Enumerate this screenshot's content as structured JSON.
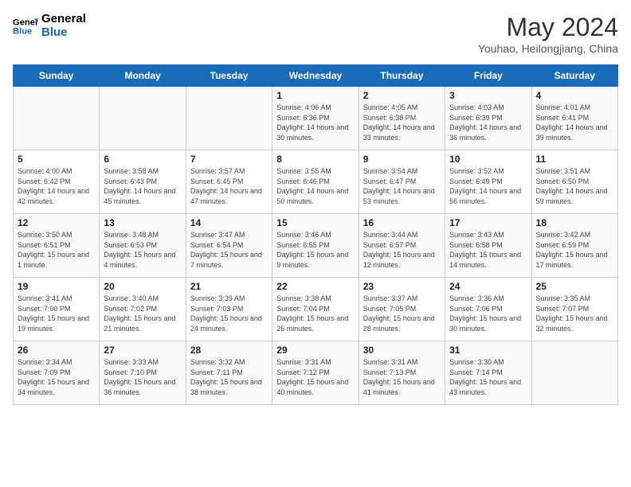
{
  "header": {
    "logo_line1": "General",
    "logo_line2": "Blue",
    "month_title": "May 2024",
    "location": "Youhao, Heilongjiang, China"
  },
  "days_of_week": [
    "Sunday",
    "Monday",
    "Tuesday",
    "Wednesday",
    "Thursday",
    "Friday",
    "Saturday"
  ],
  "weeks": [
    [
      {
        "day": "",
        "sunrise": "",
        "sunset": "",
        "daylight": ""
      },
      {
        "day": "",
        "sunrise": "",
        "sunset": "",
        "daylight": ""
      },
      {
        "day": "",
        "sunrise": "",
        "sunset": "",
        "daylight": ""
      },
      {
        "day": "1",
        "sunrise": "4:06 AM",
        "sunset": "6:36 PM",
        "daylight": "14 hours and 30 minutes."
      },
      {
        "day": "2",
        "sunrise": "4:05 AM",
        "sunset": "6:38 PM",
        "daylight": "14 hours and 33 minutes."
      },
      {
        "day": "3",
        "sunrise": "4:03 AM",
        "sunset": "6:39 PM",
        "daylight": "14 hours and 36 minutes."
      },
      {
        "day": "4",
        "sunrise": "4:01 AM",
        "sunset": "6:41 PM",
        "daylight": "14 hours and 39 minutes."
      }
    ],
    [
      {
        "day": "5",
        "sunrise": "4:00 AM",
        "sunset": "6:42 PM",
        "daylight": "14 hours and 42 minutes."
      },
      {
        "day": "6",
        "sunrise": "3:58 AM",
        "sunset": "6:43 PM",
        "daylight": "14 hours and 45 minutes."
      },
      {
        "day": "7",
        "sunrise": "3:57 AM",
        "sunset": "6:45 PM",
        "daylight": "14 hours and 47 minutes."
      },
      {
        "day": "8",
        "sunrise": "3:55 AM",
        "sunset": "6:46 PM",
        "daylight": "14 hours and 50 minutes."
      },
      {
        "day": "9",
        "sunrise": "3:54 AM",
        "sunset": "6:47 PM",
        "daylight": "14 hours and 53 minutes."
      },
      {
        "day": "10",
        "sunrise": "3:52 AM",
        "sunset": "6:49 PM",
        "daylight": "14 hours and 56 minutes."
      },
      {
        "day": "11",
        "sunrise": "3:51 AM",
        "sunset": "6:50 PM",
        "daylight": "14 hours and 59 minutes."
      }
    ],
    [
      {
        "day": "12",
        "sunrise": "3:50 AM",
        "sunset": "6:51 PM",
        "daylight": "15 hours and 1 minute."
      },
      {
        "day": "13",
        "sunrise": "3:48 AM",
        "sunset": "6:53 PM",
        "daylight": "15 hours and 4 minutes."
      },
      {
        "day": "14",
        "sunrise": "3:47 AM",
        "sunset": "6:54 PM",
        "daylight": "15 hours and 7 minutes."
      },
      {
        "day": "15",
        "sunrise": "3:46 AM",
        "sunset": "6:55 PM",
        "daylight": "15 hours and 9 minutes."
      },
      {
        "day": "16",
        "sunrise": "3:44 AM",
        "sunset": "6:57 PM",
        "daylight": "15 hours and 12 minutes."
      },
      {
        "day": "17",
        "sunrise": "3:43 AM",
        "sunset": "6:58 PM",
        "daylight": "15 hours and 14 minutes."
      },
      {
        "day": "18",
        "sunrise": "3:42 AM",
        "sunset": "6:59 PM",
        "daylight": "15 hours and 17 minutes."
      }
    ],
    [
      {
        "day": "19",
        "sunrise": "3:41 AM",
        "sunset": "7:00 PM",
        "daylight": "15 hours and 19 minutes."
      },
      {
        "day": "20",
        "sunrise": "3:40 AM",
        "sunset": "7:02 PM",
        "daylight": "15 hours and 21 minutes."
      },
      {
        "day": "21",
        "sunrise": "3:39 AM",
        "sunset": "7:03 PM",
        "daylight": "15 hours and 24 minutes."
      },
      {
        "day": "22",
        "sunrise": "3:38 AM",
        "sunset": "7:04 PM",
        "daylight": "15 hours and 26 minutes."
      },
      {
        "day": "23",
        "sunrise": "3:37 AM",
        "sunset": "7:05 PM",
        "daylight": "15 hours and 28 minutes."
      },
      {
        "day": "24",
        "sunrise": "3:36 AM",
        "sunset": "7:06 PM",
        "daylight": "15 hours and 30 minutes."
      },
      {
        "day": "25",
        "sunrise": "3:35 AM",
        "sunset": "7:07 PM",
        "daylight": "15 hours and 32 minutes."
      }
    ],
    [
      {
        "day": "26",
        "sunrise": "3:34 AM",
        "sunset": "7:09 PM",
        "daylight": "15 hours and 34 minutes."
      },
      {
        "day": "27",
        "sunrise": "3:33 AM",
        "sunset": "7:10 PM",
        "daylight": "15 hours and 36 minutes."
      },
      {
        "day": "28",
        "sunrise": "3:32 AM",
        "sunset": "7:11 PM",
        "daylight": "15 hours and 38 minutes."
      },
      {
        "day": "29",
        "sunrise": "3:31 AM",
        "sunset": "7:12 PM",
        "daylight": "15 hours and 40 minutes."
      },
      {
        "day": "30",
        "sunrise": "3:31 AM",
        "sunset": "7:13 PM",
        "daylight": "15 hours and 41 minutes."
      },
      {
        "day": "31",
        "sunrise": "3:30 AM",
        "sunset": "7:14 PM",
        "daylight": "15 hours and 43 minutes."
      },
      {
        "day": "",
        "sunrise": "",
        "sunset": "",
        "daylight": ""
      }
    ]
  ]
}
